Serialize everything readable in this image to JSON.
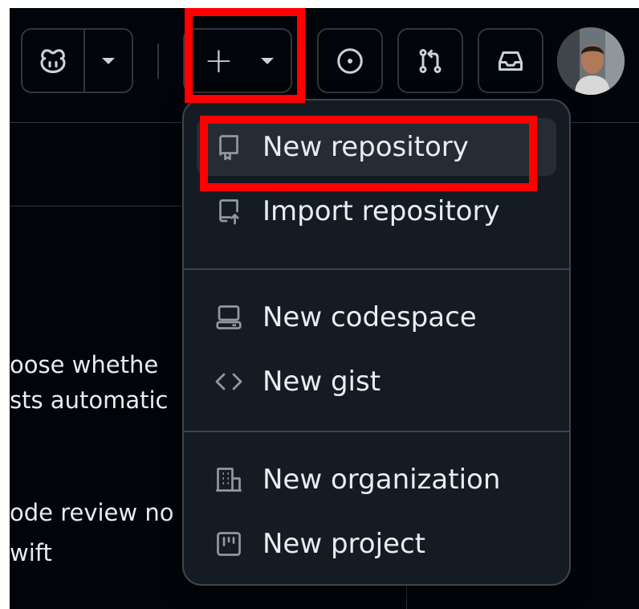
{
  "header": {
    "copilot_button": {
      "icon": "copilot-icon",
      "caret_icon": "triangle-down-icon"
    },
    "create_button": {
      "plus_glyph": "+",
      "icon": "plus-icon",
      "caret_icon": "triangle-down-icon"
    },
    "issues_button": {
      "icon": "issue-opened-icon"
    },
    "pull_requests_button": {
      "icon": "git-pull-request-icon"
    },
    "inbox_button": {
      "icon": "inbox-icon"
    },
    "avatar": {
      "icon": "user-avatar"
    }
  },
  "background_text": {
    "line1": "oose whethe",
    "line2": "sts automatic",
    "line3": "ode review no",
    "line4": "wift"
  },
  "create_menu": {
    "items": [
      {
        "label": "New repository",
        "icon": "repo-icon",
        "selected": true
      },
      {
        "label": "Import repository",
        "icon": "repo-push-icon",
        "selected": false
      },
      {
        "label": "New codespace",
        "icon": "codespaces-icon",
        "selected": false
      },
      {
        "label": "New gist",
        "icon": "code-icon",
        "selected": false
      },
      {
        "label": "New organization",
        "icon": "organization-icon",
        "selected": false
      },
      {
        "label": "New project",
        "icon": "project-icon",
        "selected": false
      }
    ]
  },
  "annotations": {
    "highlight_color": "#ff0000",
    "highlighted": [
      "create-new-button",
      "new-repository-item"
    ]
  },
  "colors": {
    "page_background": "#010409",
    "menu_background": "#151b23",
    "menu_border": "#3d444d",
    "text": "#e6edf3",
    "icon_muted": "#9198a1",
    "selected_item_background": "#262c36"
  }
}
